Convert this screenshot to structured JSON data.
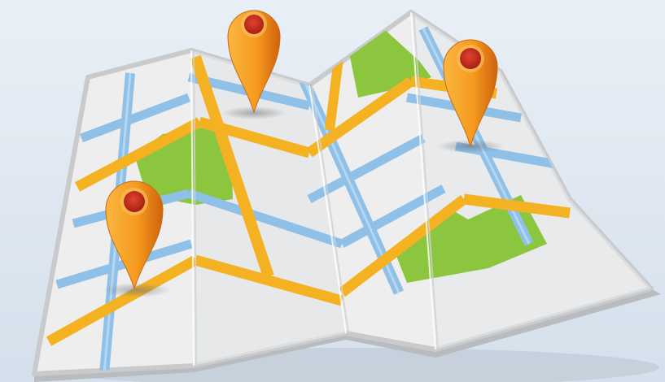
{
  "scene": {
    "subject": "folded-map-illustration",
    "colors": {
      "background_top": "#e9eff6",
      "background_bottom": "#d5e0ec",
      "paper": "#eeeeee",
      "paper_edge": "#c8cacc",
      "fold_shadow": "#d9dbdc",
      "main_road": "#f4b223",
      "side_road": "#8ec0e8",
      "park": "#8cc63f",
      "pin_body": "#f59a1e",
      "pin_dark": "#d0620d",
      "pin_center": "#c0291b"
    },
    "pins": [
      {
        "name": "map-pin-top-center"
      },
      {
        "name": "map-pin-top-right"
      },
      {
        "name": "map-pin-left"
      }
    ]
  }
}
